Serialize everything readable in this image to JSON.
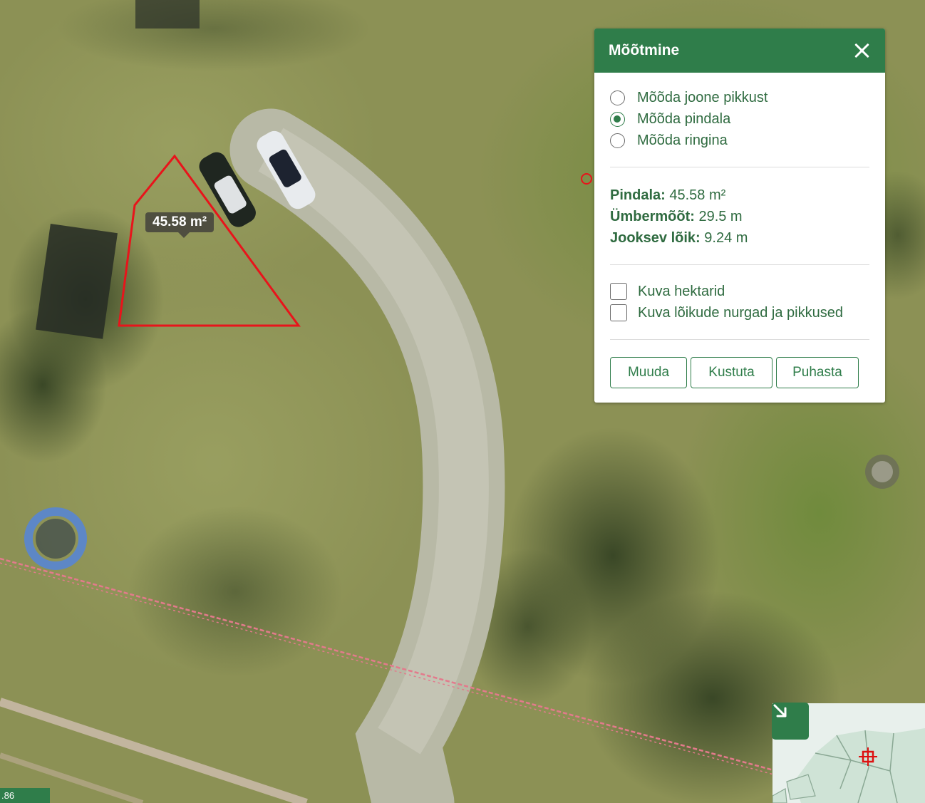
{
  "map": {
    "area_tooltip": "45.58 m²",
    "coordinate_readout": ".86"
  },
  "panel": {
    "title": "Mõõtmine",
    "modes": [
      {
        "label": "Mõõda joone pikkust",
        "checked": false
      },
      {
        "label": "Mõõda pindala",
        "checked": true
      },
      {
        "label": "Mõõda ringina",
        "checked": false
      }
    ],
    "stats": {
      "area_label": "Pindala:",
      "area_value": " 45.58 m²",
      "perimeter_label": "Ümbermõõt:",
      "perimeter_value": " 29.5 m",
      "segment_label": "Jooksev lõik:",
      "segment_value": " 9.24 m"
    },
    "options": [
      {
        "label": "Kuva hektarid",
        "checked": false
      },
      {
        "label": "Kuva lõikude nurgad ja pikkused",
        "checked": false
      }
    ],
    "buttons": {
      "edit": "Muuda",
      "delete": "Kustuta",
      "clear": "Puhasta"
    }
  },
  "colors": {
    "brand_green": "#2f7d4a",
    "measure_red": "#e8141b"
  },
  "icons": [
    "close-icon",
    "collapse-arrow-icon",
    "location-marker-icon"
  ]
}
